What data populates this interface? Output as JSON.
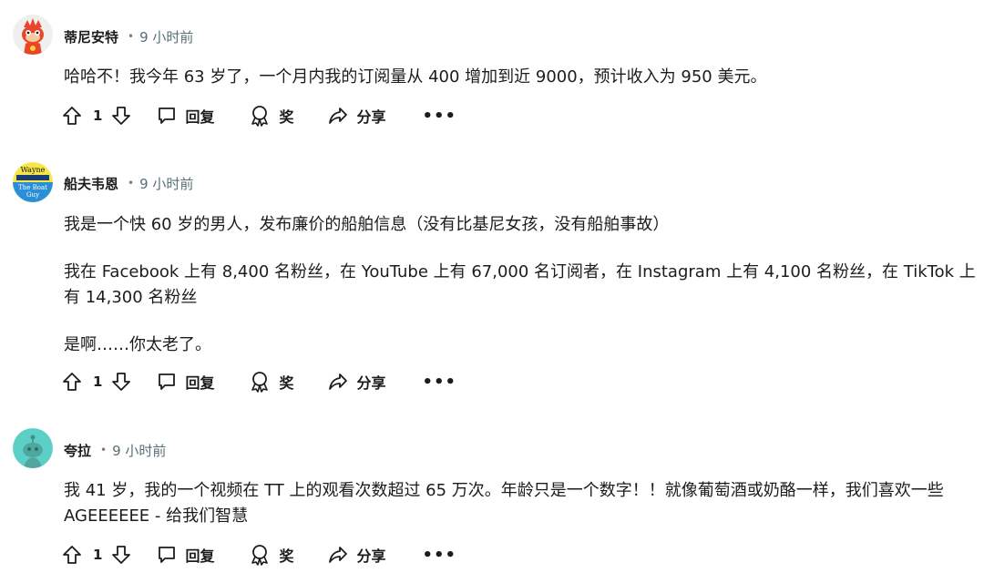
{
  "comments": [
    {
      "username": "蒂尼安特",
      "dot": "•",
      "time": "9 小时前",
      "avatar_icon": "red-flame-mascot-avatar",
      "paragraphs": [
        "哈哈不！我今年 63 岁了，一个月内我的订阅量从 400 增加到近 9000，预计收入为 950 美元。"
      ],
      "votes": "1",
      "reply_label": "回复",
      "award_label": "奖",
      "share_label": "分享",
      "more_label": "•••"
    },
    {
      "username": "船夫韦恩",
      "dot": "•",
      "time": "9 小时前",
      "avatar_icon": "boat-guy-logo-avatar",
      "avatar_text": [
        "Wayne",
        "The Boat",
        "Guy"
      ],
      "paragraphs": [
        "我是一个快 60 岁的男人，发布廉价的船舶信息（没有比基尼女孩，没有船舶事故）",
        "我在 Facebook 上有 8,400 名粉丝，在 YouTube 上有 67,000 名订阅者，在 Instagram 上有 4,100 名粉丝，在 TikTok 上有 14,300 名粉丝",
        "是啊……你太老了。"
      ],
      "votes": "1",
      "reply_label": "回复",
      "award_label": "奖",
      "share_label": "分享",
      "more_label": "•••"
    },
    {
      "username": "夸拉",
      "dot": "•",
      "time": "9 小时前",
      "avatar_icon": "teal-snoo-avatar",
      "paragraphs": [
        "我 41 岁，我的一个视频在 TT 上的观看次数超过 65 万次。年龄只是一个数字！！就像葡萄酒或奶酪一样，我们喜欢一些 AGEEEEEE - 给我们智慧"
      ],
      "votes": "1",
      "reply_label": "回复",
      "award_label": "奖",
      "share_label": "分享",
      "more_label": "•••"
    }
  ],
  "colors": {
    "text": "#1c1c1c",
    "meta": "#576f76",
    "teal_avatar": "#5ccfc6",
    "red_avatar": "#e8452a"
  }
}
